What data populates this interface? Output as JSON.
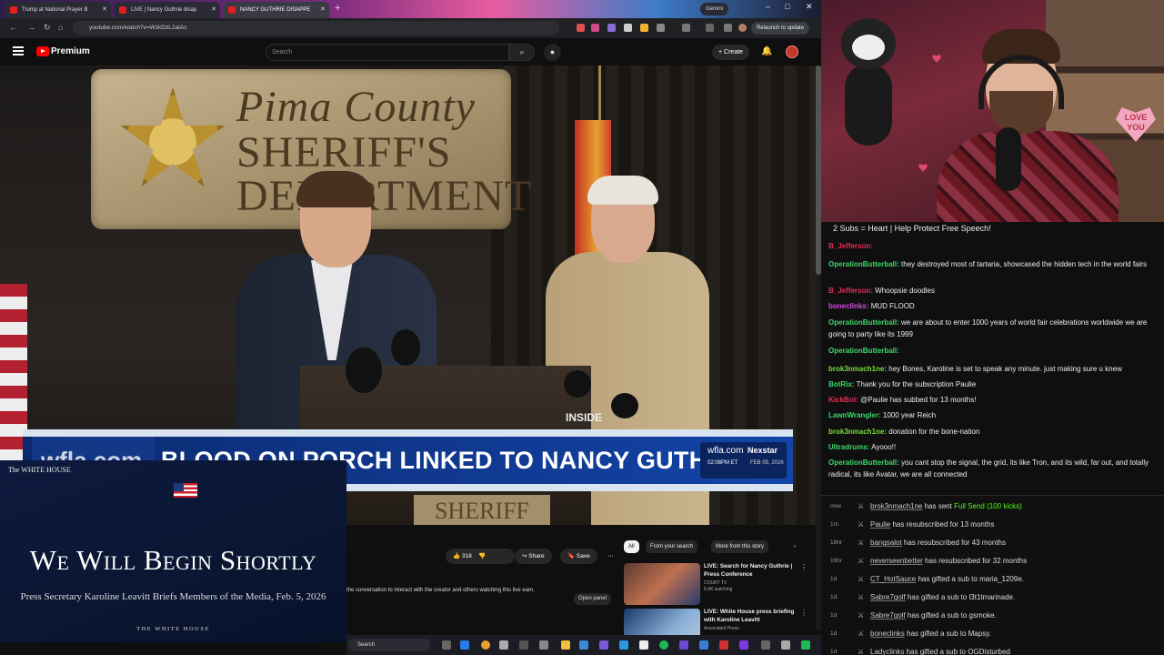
{
  "browser": {
    "tabs": [
      {
        "title": "Trump at National Prayer B"
      },
      {
        "title": "LIVE | Nancy Guthrie disap"
      },
      {
        "title": "NANCY GUTHRIE DISAPPE"
      }
    ],
    "new_tab": "+",
    "gemini_label": "Gemini",
    "url": "youtube.com/watch?v=WzkDzL2aIAc",
    "relaunch_label": "Relaunch to update",
    "window_controls": [
      "–",
      "□",
      "✕"
    ]
  },
  "youtube": {
    "premium_label": "Premium",
    "search_placeholder": "Search",
    "create_label": "Create",
    "icons": [
      "menu-icon",
      "search-icon",
      "mic-icon",
      "bell-icon"
    ]
  },
  "video": {
    "plaque_lines": [
      "Pima County",
      "SHERIFF'S",
      "DEPARTMENT"
    ],
    "podium_sign": "INSIDE",
    "bottom_sign": "SHERIFF",
    "lower_third": {
      "logo": "wfla.com",
      "headline": "BLOOD ON PORCH LINKED TO NANCY GUTHRIE",
      "station": "wfla.com",
      "network": "Nexstar",
      "time": "02:08PM ET",
      "date": "FEB 05, 2026"
    }
  },
  "whitehouse": {
    "logo": "The WHITE HOUSE",
    "title": "We Will Begin Shortly",
    "subtitle": "Press Secretary Karoline Leavitt Briefs Members of the Media, Feb. 5, 2026",
    "footer": "THE WHITE HOUSE"
  },
  "actions": {
    "likes": "318",
    "share": "Share",
    "save": "Save",
    "more": "⋯"
  },
  "live_chat_prompt": "the conversation to interact with the creator and others watching this live eam.",
  "open_panel_label": "Open panel",
  "chips": [
    "All",
    "From your search",
    "More from this story"
  ],
  "recommendations": [
    {
      "title": "LIVE: Search for Nancy Guthrie | Press Conference",
      "channel": "COURT TV",
      "meta": "6.9K watching"
    },
    {
      "title": "LIVE: White House press briefing with Karoline Leavitt",
      "channel": "Associated Press",
      "meta": ""
    }
  ],
  "taskbar": {
    "search_label": "Search"
  },
  "chat": {
    "title": "2 Subs = Heart | Help Protect Free Speech!",
    "messages": [
      {
        "user": "B_Jefferson:",
        "text": "",
        "color": "#e0305a"
      },
      {
        "user": "OperationButterball:",
        "text": "they destroyed most of tartaria, showcased the hidden tech in the world fairs",
        "color": "#3ed86a"
      },
      {
        "user": "B_Jefferson:",
        "text": "Whoopsie doodles",
        "color": "#e0305a"
      },
      {
        "user": "bonecIinks:",
        "text": "MUD FLOOD",
        "color": "#d050e0"
      },
      {
        "user": "OperationButterball:",
        "text": "we are about to enter 1000 years of world fair celebrations worldwide we are going to party like its 1999",
        "color": "#3ed86a"
      },
      {
        "user": "OperationButterball:",
        "text": "",
        "color": "#3ed86a"
      },
      {
        "user": "brok3nmach1ne:",
        "text": "hey Bones, Karoline is set to speak any minute. just making sure u knew",
        "color": "#7bdc3e"
      },
      {
        "user": "BotRix:",
        "text": "Thank you for the subscription Paulie",
        "color": "#3ed86a"
      },
      {
        "user": "KickBot:",
        "text": "@Paulie has subbed for 13 months!",
        "color": "#e0305a"
      },
      {
        "user": "LawnWrangler:",
        "text": "1000 year Reich",
        "color": "#3ed86a"
      },
      {
        "user": "brok3nmach1ne:",
        "text": "donation for the bone-nation",
        "color": "#7bdc3e"
      },
      {
        "user": "Ultradrums:",
        "text": "Ayooo!!",
        "color": "#3ed86a"
      },
      {
        "user": "OperationButterball:",
        "text": "you cant stop the signal, the grid, its like Tron, and its wild, far out, and totally radical, its like Avatar, we are all connected",
        "color": "#3ed86a"
      }
    ]
  },
  "events": [
    {
      "time": "now",
      "name": "brok3nmach1ne",
      "text": " has sent ",
      "extra": "Full Send (100 kicks)"
    },
    {
      "time": "1m",
      "name": "Paulie",
      "text": " has resubscribed for 13 months",
      "extra": ""
    },
    {
      "time": "16hr",
      "name": "bangsalot",
      "text": " has resubscribed for 43 months",
      "extra": ""
    },
    {
      "time": "16hr",
      "name": "neverseenbetter",
      "text": " has resubscribed for 32 months",
      "extra": ""
    },
    {
      "time": "1d",
      "name": "CT_HotSauce",
      "text": " has gifted a sub to ",
      "extra": "maria_1209e."
    },
    {
      "time": "1d",
      "name": "Sabre7golf",
      "text": " has gifted a sub to ",
      "extra": "l3t1tmarinade."
    },
    {
      "time": "1d",
      "name": "Sabre7golf",
      "text": " has gifted a sub to ",
      "extra": "gsmoke."
    },
    {
      "time": "1d",
      "name": "boneclinks",
      "text": " has gifted a sub to ",
      "extra": "Mapsy."
    },
    {
      "time": "1d",
      "name": "Ladyclinks",
      "text": " has gifted a sub to ",
      "extra": "OGDisturbed"
    }
  ],
  "webcam": {
    "love_sign": "LOVE YOU"
  },
  "colors": {
    "youtube_red": "#ff0000",
    "kick_green": "#53fc18",
    "chat_bg": "#0f0f0f"
  }
}
